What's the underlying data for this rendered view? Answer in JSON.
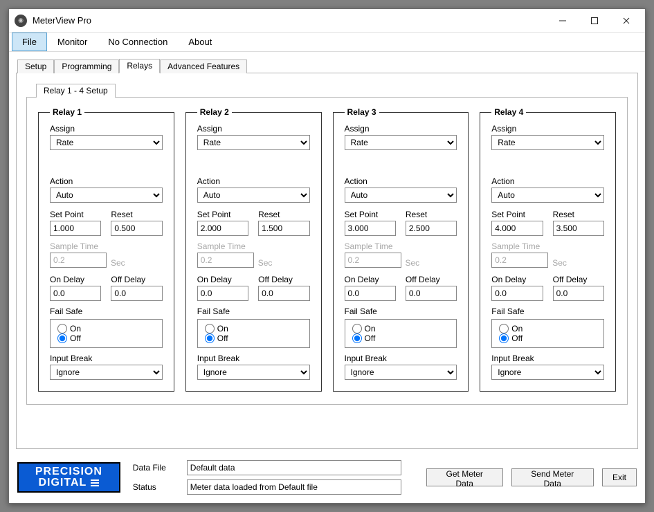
{
  "window": {
    "title": "MeterView Pro"
  },
  "menu": {
    "file": "File",
    "monitor": "Monitor",
    "noconn": "No Connection",
    "about": "About"
  },
  "tabs": {
    "setup": "Setup",
    "programming": "Programming",
    "relays": "Relays",
    "advanced": "Advanced Features"
  },
  "innerTab": "Relay 1 - 4 Setup",
  "labels": {
    "assign": "Assign",
    "action": "Action",
    "setpoint": "Set Point",
    "reset": "Reset",
    "sampletime": "Sample Time",
    "sec": "Sec",
    "ondelay": "On Delay",
    "offdelay": "Off Delay",
    "failsafe": "Fail Safe",
    "on": "On",
    "off": "Off",
    "inputbreak": "Input Break"
  },
  "relays": [
    {
      "title": "Relay 1",
      "assign": "Rate",
      "action": "Auto",
      "setpoint": "1.000",
      "reset": "0.500",
      "sampletime": "0.2",
      "ondelay": "0.0",
      "offdelay": "0.0",
      "failsafe": "off",
      "inputbreak": "Ignore"
    },
    {
      "title": "Relay 2",
      "assign": "Rate",
      "action": "Auto",
      "setpoint": "2.000",
      "reset": "1.500",
      "sampletime": "0.2",
      "ondelay": "0.0",
      "offdelay": "0.0",
      "failsafe": "off",
      "inputbreak": "Ignore"
    },
    {
      "title": "Relay 3",
      "assign": "Rate",
      "action": "Auto",
      "setpoint": "3.000",
      "reset": "2.500",
      "sampletime": "0.2",
      "ondelay": "0.0",
      "offdelay": "0.0",
      "failsafe": "off",
      "inputbreak": "Ignore"
    },
    {
      "title": "Relay 4",
      "assign": "Rate",
      "action": "Auto",
      "setpoint": "4.000",
      "reset": "3.500",
      "sampletime": "0.2",
      "ondelay": "0.0",
      "offdelay": "0.0",
      "failsafe": "off",
      "inputbreak": "Ignore"
    }
  ],
  "footer": {
    "logo1": "PRECISION",
    "logo2": "DIGITAL",
    "datafile_label": "Data File",
    "datafile": "Default data",
    "status_label": "Status",
    "status": "Meter data loaded from Default file",
    "getdata": "Get Meter Data",
    "senddata": "Send Meter Data",
    "exit": "Exit"
  }
}
